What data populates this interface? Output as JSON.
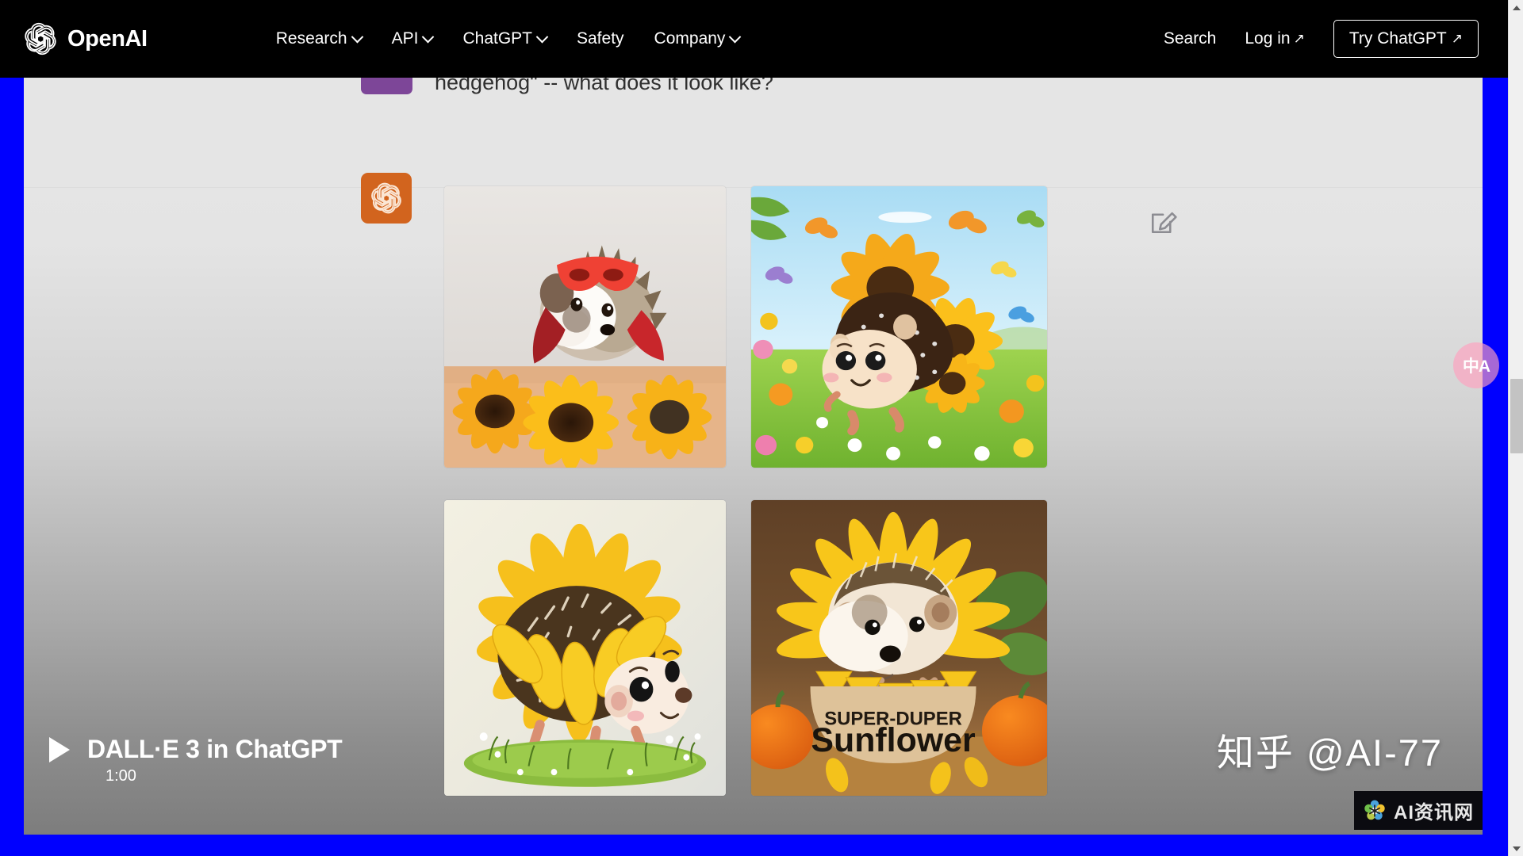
{
  "nav": {
    "brand": "OpenAI",
    "brand_icon": "openai-logo-icon",
    "links": [
      {
        "label": "Research",
        "has_caret": true
      },
      {
        "label": "API",
        "has_caret": true
      },
      {
        "label": "ChatGPT",
        "has_caret": true
      },
      {
        "label": "Safety",
        "has_caret": false
      },
      {
        "label": "Company",
        "has_caret": true
      }
    ],
    "search_label": "Search",
    "login_label": "Log in",
    "login_arrow": "↗",
    "cta_label": "Try ChatGPT",
    "cta_arrow": "↗"
  },
  "conversation": {
    "user_message": "hedgehog\" -- what does it look like?",
    "edit_icon": "edit-pencil-icon",
    "assistant_avatar_icon": "openai-logo-icon",
    "images": [
      {
        "id": "img-1",
        "alt": "Photorealistic hedgehog wearing a red superhero mask and cape sitting behind a row of sunflowers",
        "position": "top-left"
      },
      {
        "id": "img-2",
        "alt": "Cartoon hedgehog with sunflower-petal spines walking in a flower meadow with butterflies",
        "position": "top-right"
      },
      {
        "id": "img-3",
        "alt": "Illustrated hedgehog whose quills are framed by a large yellow sunflower, standing on grass",
        "position": "bottom-left"
      },
      {
        "id": "img-4",
        "alt": "Hedgehog peeking out of a sunflower-shaped bowl labeled SUPER-DUPER Sunflower with pumpkins",
        "position": "bottom-right",
        "caption_top": "SUPER-DUPER",
        "caption_main": "Sunflower"
      }
    ]
  },
  "video": {
    "title": "DALL·E 3 in ChatGPT",
    "duration": "1:00",
    "play_icon": "play-triangle-icon"
  },
  "watermarks": {
    "zhihu": "知乎 @AI-77",
    "ainews": "AI资讯网",
    "ainews_icon": "flower-logo-icon"
  },
  "translate_widget": {
    "label": "中A",
    "icon": "translate-icon"
  },
  "scrollbar": {
    "up_icon": "chevron-up-icon",
    "down_icon": "chevron-down-icon"
  },
  "colors": {
    "navbar_bg": "#000000",
    "frame_blue": "#0000FF",
    "assistant_orange": "#D2641E",
    "user_purple": "#7D4698",
    "page_bg_top": "#E7E7E7",
    "page_bg_bottom": "#7D7D7D"
  }
}
